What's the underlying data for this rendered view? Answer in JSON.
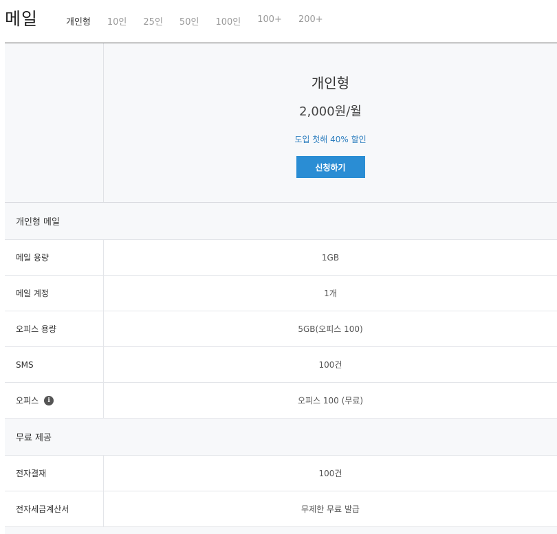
{
  "header": {
    "title": "메일",
    "tabs": [
      {
        "label": "개인형",
        "active": true
      },
      {
        "label": "10인",
        "active": false
      },
      {
        "label": "25인",
        "active": false
      },
      {
        "label": "50인",
        "active": false
      },
      {
        "label": "100인",
        "active": false
      },
      {
        "label": "100+",
        "active": false
      },
      {
        "label": "200+",
        "active": false
      }
    ]
  },
  "plan": {
    "name": "개인형",
    "price": "2,000원/월",
    "discount": "도입 첫해 40% 할인",
    "apply_label": "신청하기"
  },
  "sections": [
    {
      "title": "개인형 메일",
      "rows": [
        {
          "label": "메일 용량",
          "value": "1GB"
        },
        {
          "label": "메일 계정",
          "value": "1개"
        },
        {
          "label": "오피스 용량",
          "value": "5GB(오피스 100)"
        },
        {
          "label": "SMS",
          "value": "100건"
        },
        {
          "label": "오피스",
          "value": "오피스 100 (무료)",
          "info_icon": "info-icon"
        }
      ]
    },
    {
      "title": "무료 제공",
      "rows": [
        {
          "label": "전자결재",
          "value": "100건"
        },
        {
          "label": "전자세금계산서",
          "value": "무제한 무료 발급"
        }
      ]
    }
  ],
  "colors": {
    "accent": "#2a8dd4",
    "discount_text": "#2f7fbf",
    "section_bg": "#f7f8fa"
  }
}
